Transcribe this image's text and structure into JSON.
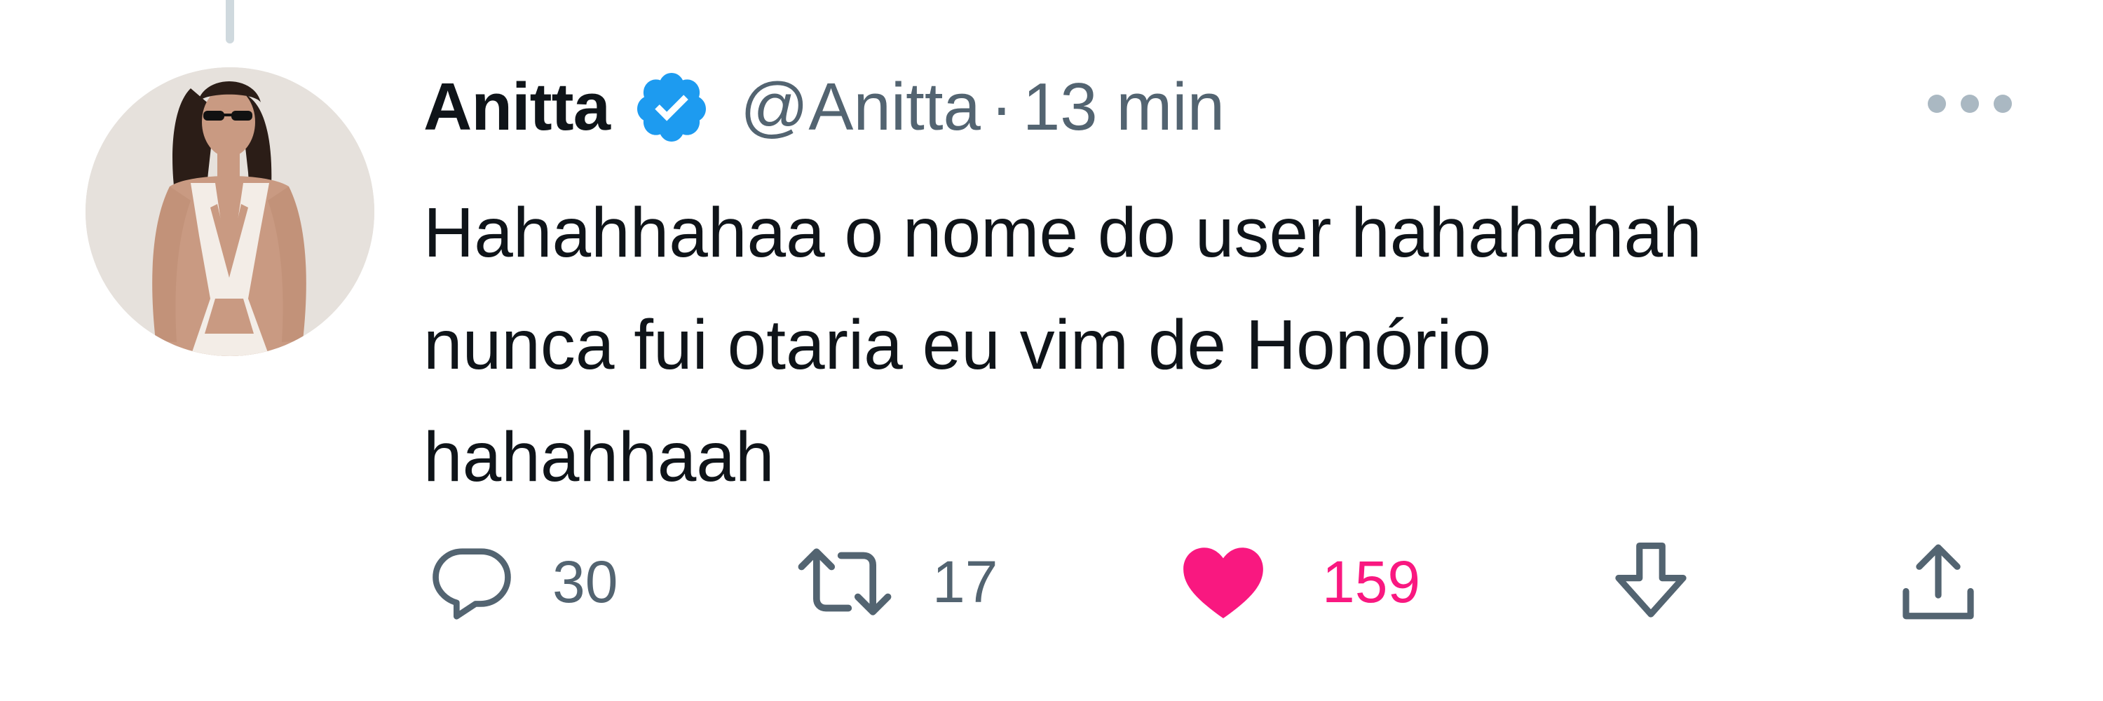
{
  "tweet": {
    "author": {
      "display_name": "Anitta",
      "handle": "@Anitta",
      "verified": true,
      "avatar": "avatar-photo"
    },
    "separator": "·",
    "timestamp": "13 min",
    "text_lines": [
      "Hahahhahaa o nome do user hahahahah",
      "nunca fui otaria eu vim de Honório",
      "hahahhaah"
    ],
    "actions": {
      "reply": {
        "icon": "reply-icon",
        "count": "30"
      },
      "retweet": {
        "icon": "retweet-icon",
        "count": "17"
      },
      "like": {
        "icon": "heart-filled-icon",
        "count": "159",
        "liked": true
      },
      "bookmark": {
        "icon": "arrow-down-icon"
      },
      "share": {
        "icon": "share-icon"
      }
    },
    "more_icon": "more-horizontal-icon"
  },
  "colors": {
    "text": "#0f1419",
    "secondary": "#536471",
    "verified": "#1d9bf0",
    "like": "#f91880",
    "thread_line": "#cfd9de"
  }
}
